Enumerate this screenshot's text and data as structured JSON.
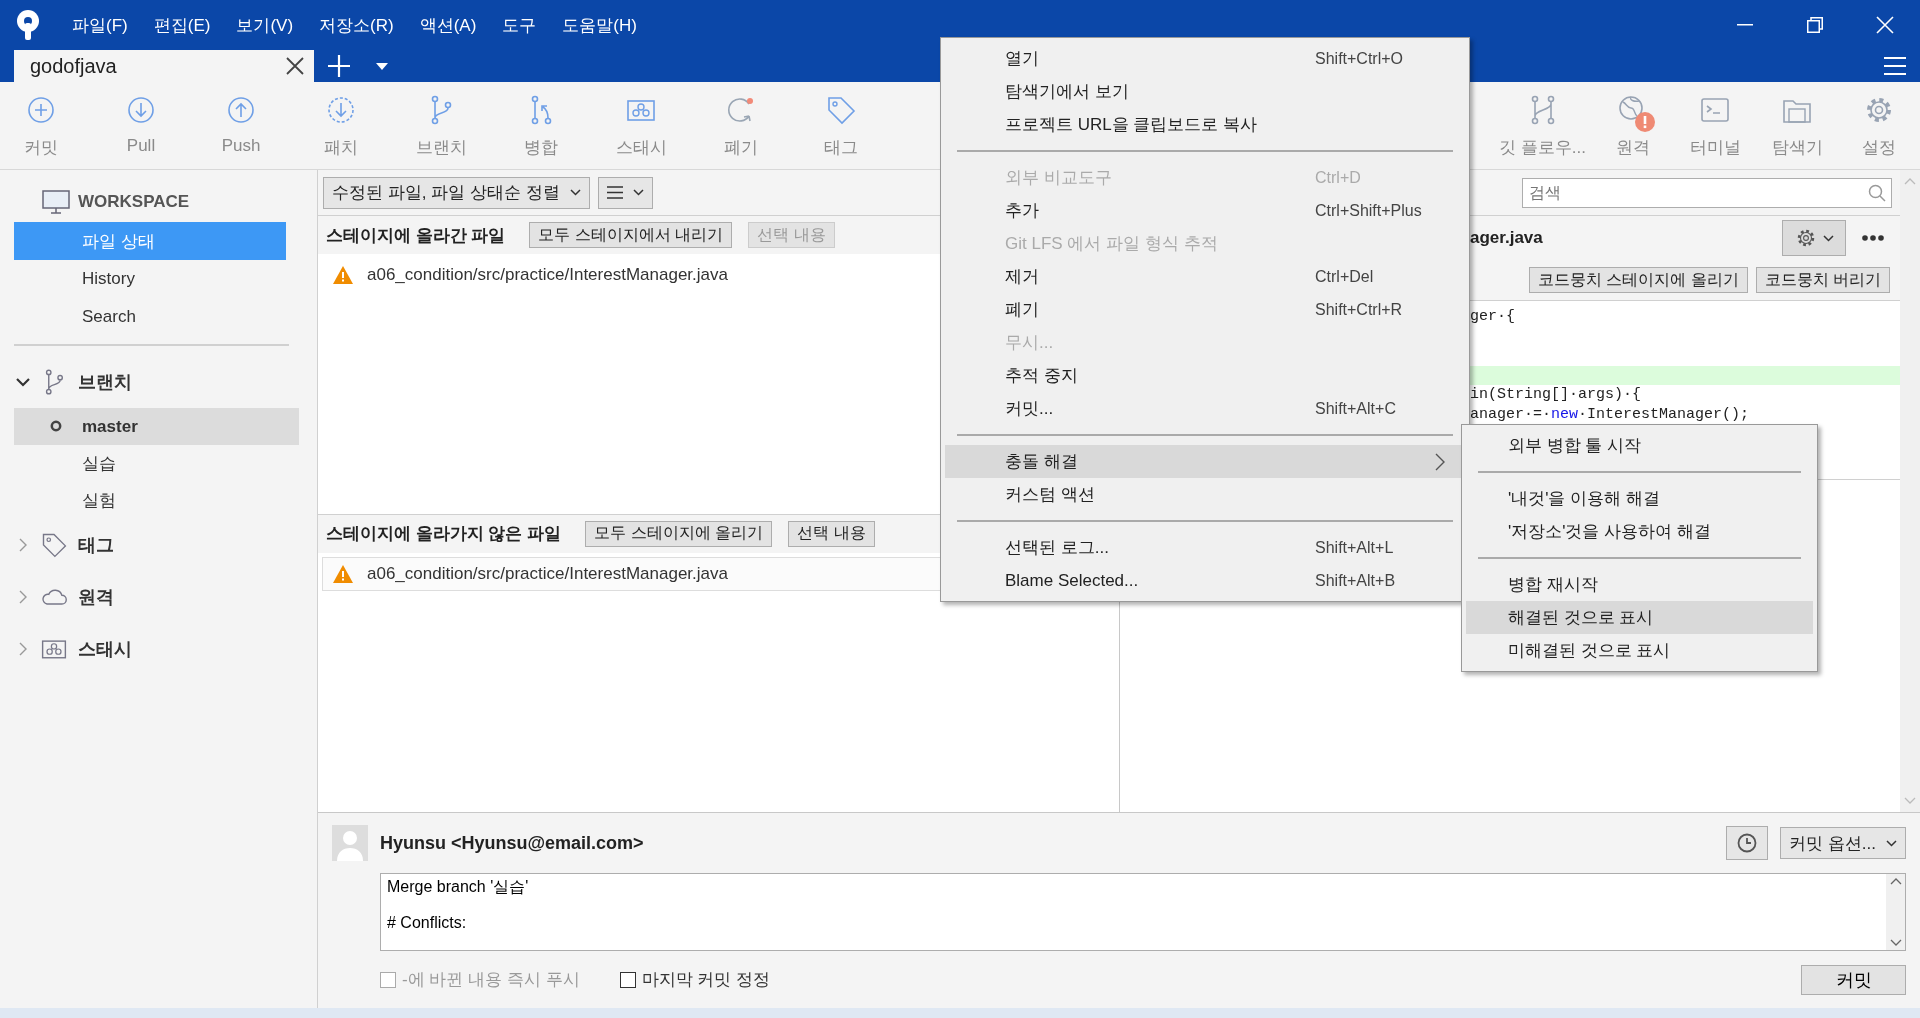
{
  "window": {
    "menu": [
      "파일(F)",
      "편집(E)",
      "보기(V)",
      "저장소(R)",
      "액션(A)",
      "도구",
      "도움말(H)"
    ]
  },
  "tabs": [
    {
      "label": "godofjava",
      "selected": true
    }
  ],
  "toolbar": {
    "left": [
      {
        "kind": "commit",
        "label": "커밋",
        "alert": false
      },
      {
        "kind": "pull",
        "label": "Pull",
        "alert": false
      },
      {
        "kind": "push",
        "label": "Push",
        "alert": false
      },
      {
        "kind": "patch",
        "label": "패치",
        "alert": false
      },
      {
        "kind": "branch",
        "label": "브랜치",
        "alert": false
      },
      {
        "kind": "merge",
        "label": "병합",
        "alert": false
      },
      {
        "kind": "stash",
        "label": "스태시",
        "alert": false
      },
      {
        "kind": "discard",
        "label": "폐기",
        "alert": false
      },
      {
        "kind": "tag",
        "label": "태그",
        "alert": false
      }
    ],
    "right": [
      {
        "kind": "gitflow",
        "label": "깃 플로우...",
        "alert": false
      },
      {
        "kind": "remote",
        "label": "원격",
        "alert": true
      },
      {
        "kind": "terminal",
        "label": "터미널",
        "alert": false
      },
      {
        "kind": "explorer",
        "label": "탐색기",
        "alert": false
      },
      {
        "kind": "settings",
        "label": "설정",
        "alert": false
      }
    ]
  },
  "sidebar": {
    "workspace": "WORKSPACE",
    "workspace_items": [
      {
        "label": "파일 상태",
        "selected": true
      },
      {
        "label": "History",
        "selected": false
      },
      {
        "label": "Search",
        "selected": false
      }
    ],
    "sections": [
      {
        "kind": "branch",
        "label": "브랜치",
        "expanded": true,
        "children": [
          {
            "label": "master",
            "selected": true,
            "current": true
          },
          {
            "label": "실습",
            "selected": false,
            "current": false
          },
          {
            "label": "실험",
            "selected": false,
            "current": false
          }
        ]
      },
      {
        "kind": "tag",
        "label": "태그",
        "expanded": false
      },
      {
        "kind": "remote",
        "label": "원격",
        "expanded": false
      },
      {
        "kind": "stash",
        "label": "스태시",
        "expanded": false
      }
    ]
  },
  "file_status": {
    "sort_dropdown": "수정된 파일, 파일 상태순 정렬",
    "staged": {
      "title": "스테이지에 올라간 파일",
      "buttons": [
        {
          "label": "모두 스테이지에서 내리기",
          "disabled": false
        },
        {
          "label": "선택 내용",
          "disabled": true
        }
      ],
      "files": [
        {
          "path": "a06_condition/src/practice/InterestManager.java",
          "conflict": true,
          "selected": false
        }
      ]
    },
    "unstaged": {
      "title": "스테이지에 올라가지 않은 파일",
      "buttons": [
        {
          "label": "모두 스테이지에 올리기",
          "disabled": false
        },
        {
          "label": "선택 내용",
          "disabled": false
        }
      ],
      "files": [
        {
          "path": "a06_condition/src/practice/InterestManager.java",
          "conflict": true,
          "selected": true
        }
      ]
    }
  },
  "diff": {
    "search_placeholder": "검색",
    "filename": "ager.java",
    "hunk_buttons": [
      "코드뭉치 스테이지에 올리기",
      "코드뭉치 버리기"
    ],
    "lines": [
      {
        "added": false,
        "tokens": [
          {
            "text": "ger·{",
            "kind": "plain"
          }
        ]
      },
      {
        "added": false
      },
      {
        "added": false
      },
      {
        "added": true
      },
      {
        "added": false,
        "tokens": [
          {
            "text": "in(String[]·args)·{",
            "kind": "plain"
          }
        ]
      },
      {
        "added": false,
        "tokens": [
          {
            "text": "anager·=·",
            "kind": "plain"
          },
          {
            "text": "new",
            "kind": "keyword"
          },
          {
            "text": "·InterestManager();",
            "kind": "plain"
          }
        ]
      }
    ]
  },
  "commit": {
    "author": "Hyunsu <Hyunsu@email.com>",
    "options": "커밋 옵션...",
    "message": "Merge branch '실습'\n\n# Conflicts:",
    "push_checkbox": {
      "label": "-에 바뀐 내용 즉시 푸시",
      "checked": false,
      "disabled": true
    },
    "amend_checkbox": {
      "label": "마지막 커밋 정정",
      "checked": false,
      "disabled": false
    },
    "commit_button": "커밋"
  },
  "context_menu": {
    "items": [
      {
        "kind": "item",
        "label": "열기",
        "shortcut": "Shift+Ctrl+O",
        "disabled": false,
        "selected": false,
        "submenu": false
      },
      {
        "kind": "item",
        "label": "탐색기에서 보기",
        "disabled": false,
        "selected": false,
        "submenu": false
      },
      {
        "kind": "item",
        "label": "프로젝트 URL을 클립보드로 복사",
        "disabled": false,
        "selected": false,
        "submenu": false
      },
      {
        "kind": "separator"
      },
      {
        "kind": "item",
        "label": "외부 비교도구",
        "shortcut": "Ctrl+D",
        "disabled": true,
        "selected": false,
        "submenu": false
      },
      {
        "kind": "item",
        "label": "추가",
        "shortcut": "Ctrl+Shift+Plus",
        "disabled": false,
        "selected": false,
        "submenu": false
      },
      {
        "kind": "item",
        "label": "Git LFS 에서 파일 형식 추적",
        "disabled": true,
        "selected": false,
        "submenu": false
      },
      {
        "kind": "item",
        "label": "제거",
        "shortcut": "Ctrl+Del",
        "disabled": false,
        "selected": false,
        "submenu": false
      },
      {
        "kind": "item",
        "label": "폐기",
        "shortcut": "Shift+Ctrl+R",
        "disabled": false,
        "selected": false,
        "submenu": false
      },
      {
        "kind": "item",
        "label": "무시...",
        "disabled": true,
        "selected": false,
        "submenu": false
      },
      {
        "kind": "item",
        "label": "추적 중지",
        "disabled": false,
        "selected": false,
        "submenu": false
      },
      {
        "kind": "item",
        "label": "커밋...",
        "shortcut": "Shift+Alt+C",
        "disabled": false,
        "selected": false,
        "submenu": false
      },
      {
        "kind": "separator"
      },
      {
        "kind": "item",
        "label": "충돌 해결",
        "disabled": false,
        "selected": true,
        "submenu": true
      },
      {
        "kind": "item",
        "label": "커스텀 액션",
        "disabled": false,
        "selected": false,
        "submenu": false
      },
      {
        "kind": "separator"
      },
      {
        "kind": "item",
        "label": "선택된 로그...",
        "shortcut": "Shift+Alt+L",
        "disabled": false,
        "selected": false,
        "submenu": false
      },
      {
        "kind": "item",
        "label": "Blame Selected...",
        "shortcut": "Shift+Alt+B",
        "disabled": false,
        "selected": false,
        "submenu": false
      }
    ]
  },
  "submenu": {
    "items": [
      {
        "kind": "item",
        "label": "외부 병합 툴 시작",
        "disabled": false,
        "selected": false,
        "submenu": false
      },
      {
        "kind": "separator"
      },
      {
        "kind": "item",
        "label": "'내것'을 이용해 해결",
        "disabled": false,
        "selected": false,
        "submenu": false
      },
      {
        "kind": "item",
        "label": "'저장소'것을 사용하여 해결",
        "disabled": false,
        "selected": false,
        "submenu": false
      },
      {
        "kind": "separator"
      },
      {
        "kind": "item",
        "label": "병합 재시작",
        "disabled": false,
        "selected": false,
        "submenu": false
      },
      {
        "kind": "item",
        "label": "해결된 것으로 표시",
        "disabled": false,
        "selected": true,
        "submenu": false
      },
      {
        "kind": "item",
        "label": "미해결된 것으로 표시",
        "disabled": false,
        "selected": false,
        "submenu": false
      }
    ]
  }
}
